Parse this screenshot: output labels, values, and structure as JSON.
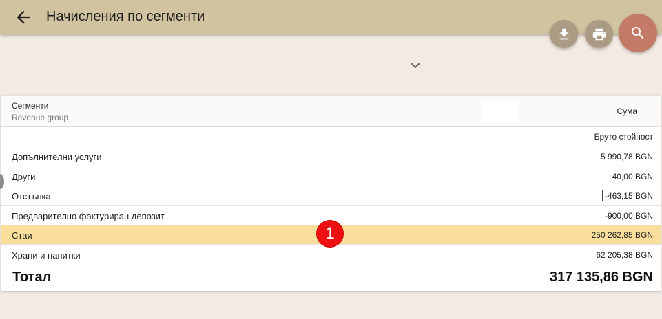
{
  "header": {
    "title": "Начисления по сегменти"
  },
  "toolbar": {
    "back_icon": "arrow-back-icon",
    "download_icon": "download-icon",
    "print_icon": "print-icon",
    "search_icon": "search-icon"
  },
  "filters": {
    "expand_icon": "chevron-down-icon"
  },
  "table": {
    "column_header": "Сегменти",
    "column_subheader": "Revenue group",
    "amount_header": "Сума",
    "amount_subheader": "Бруто стойност",
    "rows": [
      {
        "label": "Допълнителни услуги",
        "value": "5 990,78 BGN"
      },
      {
        "label": "Други",
        "value": "40,00 BGN"
      },
      {
        "label": "Отстъпка",
        "value": "-463,15 BGN"
      },
      {
        "label": "Предварително фактуриран депозит",
        "value": "-900,00 BGN"
      },
      {
        "label": "Стаи",
        "value": "250 262,85 BGN",
        "selected": true
      },
      {
        "label": "Храни и напитки",
        "value": "62 205,38 BGN"
      }
    ],
    "total_label": "Тотал",
    "total_value": "317 135,86 BGN"
  },
  "annotation": {
    "marker": "1",
    "color": "#ee1111"
  },
  "colors": {
    "appbar": "#d2c3a0",
    "background": "#f3ebe3",
    "fab": "#ab9b84",
    "fab_search": "#c37a66",
    "selected_row": "#fadf9c"
  }
}
